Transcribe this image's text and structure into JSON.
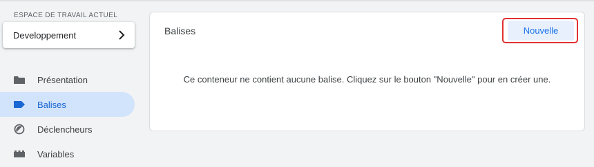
{
  "workspace": {
    "label": "ESPACE DE TRAVAIL ACTUEL",
    "name": "Developpement",
    "chevron_icon": "chevron-right-icon"
  },
  "nav": {
    "items": [
      {
        "label": "Présentation",
        "icon": "folder-icon",
        "active": false
      },
      {
        "label": "Balises",
        "icon": "tag-icon",
        "active": true
      },
      {
        "label": "Déclencheurs",
        "icon": "trigger-icon",
        "active": false
      },
      {
        "label": "Variables",
        "icon": "variables-icon",
        "active": false
      }
    ]
  },
  "panel": {
    "title": "Balises",
    "new_button_label": "Nouvelle",
    "empty_message": "Ce conteneur ne contient aucune balise. Cliquez sur le bouton \"Nouvelle\" pour en créer une."
  },
  "colors": {
    "accent": "#1a73e8",
    "active_nav_bg": "#d2e3fc",
    "highlight": "#e03131"
  }
}
